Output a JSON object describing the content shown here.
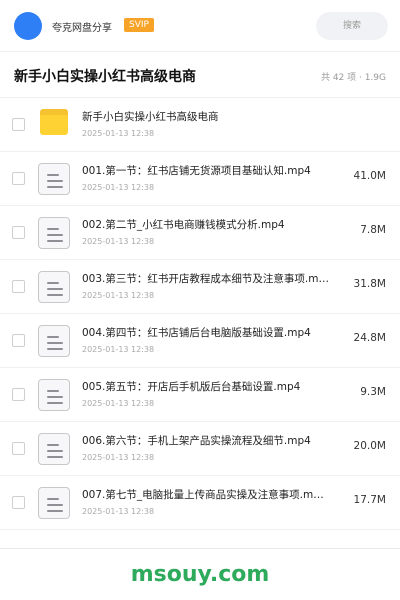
{
  "header": {
    "username": "夸克网盘分享",
    "vip_badge": "SVIP",
    "search_label": "搜索"
  },
  "folder": {
    "title": "新手小白实操小红书高级电商",
    "meta": "共 42 项 · 1.9G"
  },
  "files": [
    {
      "type": "folder",
      "name": "新手小白实操小红书高级电商",
      "date": "2025-01-13 12:38",
      "size": ""
    },
    {
      "type": "file",
      "name": "001.第一节：红书店铺无货源项目基础认知.mp4",
      "date": "2025-01-13 12:38",
      "size": "41.0M"
    },
    {
      "type": "file",
      "name": "002.第二节_小红书电商赚钱模式分析.mp4",
      "date": "2025-01-13 12:38",
      "size": "7.8M"
    },
    {
      "type": "file",
      "name": "003.第三节：红书开店教程成本细节及注意事项.m…",
      "date": "2025-01-13 12:38",
      "size": "31.8M"
    },
    {
      "type": "file",
      "name": "004.第四节：红书店铺后台电脑版基础设置.mp4",
      "date": "2025-01-13 12:38",
      "size": "24.8M"
    },
    {
      "type": "file",
      "name": "005.第五节：开店后手机版后台基础设置.mp4",
      "date": "2025-01-13 12:38",
      "size": "9.3M"
    },
    {
      "type": "file",
      "name": "006.第六节：手机上架产品实操流程及细节.mp4",
      "date": "2025-01-13 12:38",
      "size": "20.0M"
    },
    {
      "type": "file",
      "name": "007.第七节_电脑批量上传商品实操及注意事项.m…",
      "date": "2025-01-13 12:38",
      "size": "17.7M"
    }
  ],
  "watermark": "msouy.com",
  "colors": {
    "avatar": "#2e7ff5",
    "vip": "#f7a327",
    "folder": "#ffd233",
    "watermark": "#2eaa5c"
  }
}
